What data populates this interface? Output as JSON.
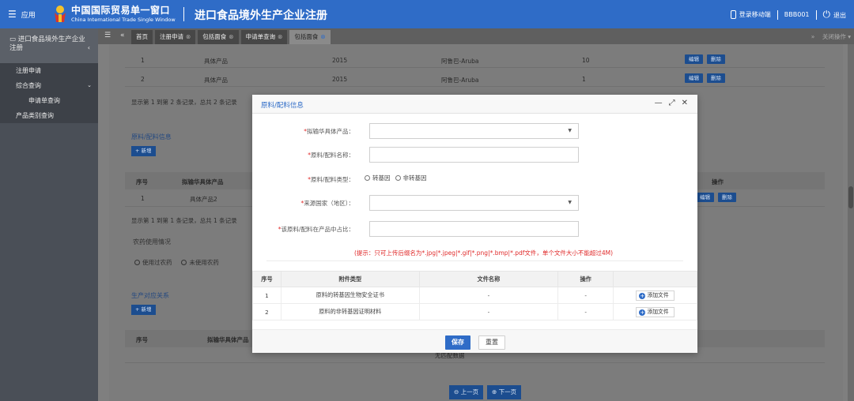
{
  "header": {
    "apps_label": "应用",
    "brand_cn": "中国国际贸易单一窗口",
    "brand_en": "China International Trade Single Window",
    "system_title": "进口食品境外生产企业注册",
    "mobile_login": "登录移动端",
    "user": "BBB001",
    "logout": "退出"
  },
  "sidebar": {
    "module_title": "进口食品境外生产企业注册",
    "items": [
      {
        "label": "注册申请"
      },
      {
        "label": "综合查询"
      },
      {
        "label": "申请单查询"
      },
      {
        "label": "产品类别查询"
      }
    ]
  },
  "tabs": {
    "items": [
      {
        "label": "首页"
      },
      {
        "label": "注册申请"
      },
      {
        "label": "包括面食"
      },
      {
        "label": "申请单查询"
      },
      {
        "label": "包括面食"
      }
    ],
    "close_ops": "关闭操作"
  },
  "background": {
    "rows": [
      {
        "no": "1",
        "product": "具体产品",
        "year": "2015",
        "country": "阿鲁巴-Aruba",
        "qty": "10"
      },
      {
        "no": "2",
        "product": "具体产品",
        "year": "2015",
        "country": "阿鲁巴-Aruba",
        "qty": "1"
      }
    ],
    "edit_label": "编辑",
    "delete_label": "删除",
    "summary1": "显示第 1 到第 2 条记录，总共 2 条记录",
    "section_materials": "原料/配料信息",
    "add_label": "+ 新增",
    "table2_headers": {
      "no": "序号",
      "product": "拟输华具体产品",
      "ops": "操作"
    },
    "table2_row": {
      "no": "1",
      "product": "具体产品2"
    },
    "summary2": "显示第 1 到第 1 条记录，总共 1 条记录",
    "section_pesticide": "农药使用情况",
    "pesticide_used": "使用过农药",
    "pesticide_unused": "未使用农药",
    "section_production": "生产对应关系",
    "table3_headers": {
      "no": "序号",
      "product": "拟输华具体产品"
    },
    "no_data": "无匹配数据",
    "prev_page": "上一页",
    "next_page": "下一页"
  },
  "modal": {
    "title": "原料/配料信息",
    "fields": {
      "product_label": "拟输华具体产品：",
      "name_label": "原料/配料名称：",
      "type_label": "原料/配料类型：",
      "type_options": [
        "转基因",
        "非转基因"
      ],
      "origin_label": "来源国家（地区）：",
      "ratio_label": "该原料/配料在产品中占比："
    },
    "hint": "(提示：只可上传后缀名为*.jpg|*.jpeg|*.gif|*.png|*.bmp|*.pdf文件，单个文件大小不能超过4M)",
    "attachments": {
      "headers": [
        "序号",
        "附件类型",
        "文件名称",
        "操作",
        ""
      ],
      "rows": [
        {
          "no": "1",
          "type": "原料的转基因生物安全证书",
          "file": "-",
          "op": "-",
          "action": "添加文件"
        },
        {
          "no": "2",
          "type": "原料的非转基因证明材料",
          "file": "-",
          "op": "-",
          "action": "添加文件"
        }
      ]
    },
    "save": "保存",
    "reset": "重置"
  }
}
